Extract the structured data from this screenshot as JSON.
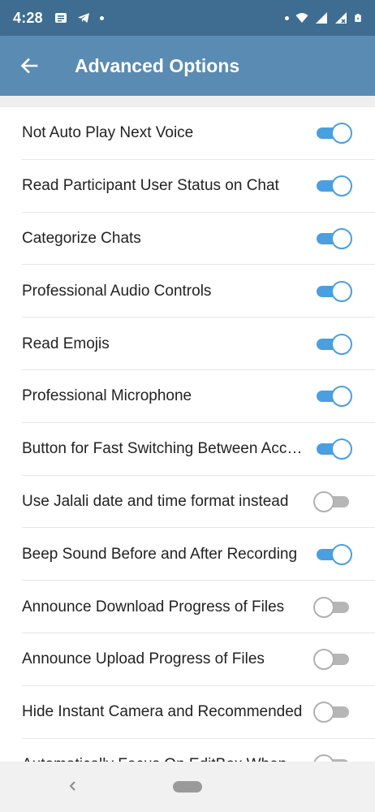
{
  "status_bar": {
    "time": "4:28",
    "left_icons": [
      "message-icon",
      "telegram-icon",
      "dot-icon"
    ],
    "right_icons": [
      "dot-icon",
      "wifi-icon",
      "signal-icon",
      "signal-no-data-icon",
      "battery-charging-icon"
    ]
  },
  "app_bar": {
    "title": "Advanced Options",
    "back_icon": "arrow-left-icon"
  },
  "settings": [
    {
      "label": "Not Auto Play Next Voice",
      "on": true
    },
    {
      "label": "Read Participant User Status on Chat",
      "on": true
    },
    {
      "label": "Categorize Chats",
      "on": true
    },
    {
      "label": "Professional Audio Controls",
      "on": true
    },
    {
      "label": "Read Emojis",
      "on": true
    },
    {
      "label": "Professional Microphone",
      "on": true
    },
    {
      "label": "Button for Fast Switching Between Accounts",
      "on": true
    },
    {
      "label": "Use Jalali date and time format instead",
      "on": false
    },
    {
      "label": "Beep Sound Before and After Recording",
      "on": true
    },
    {
      "label": "Announce Download Progress of Files",
      "on": false
    },
    {
      "label": "Announce Upload Progress of Files",
      "on": false
    },
    {
      "label": "Hide Instant Camera and Recommended",
      "on": false
    },
    {
      "label": "Automatically Focus On EditBox When",
      "on": false
    }
  ],
  "colors": {
    "status_bar": "#3e6d91",
    "app_bar": "#5a8bb3",
    "toggle_on": "#4a9fe0",
    "toggle_off": "#b6b6b6"
  }
}
